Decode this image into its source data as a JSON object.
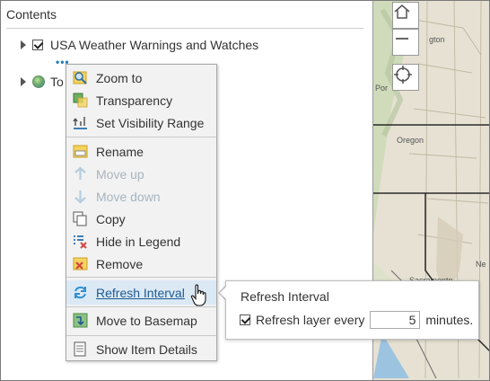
{
  "contents": {
    "title": "Contents",
    "layers": [
      {
        "label": "USA Weather Warnings and Watches",
        "checked": true
      },
      {
        "label": "To"
      }
    ]
  },
  "menu": {
    "items": [
      {
        "label": "Zoom to",
        "icon": "zoom-to-icon",
        "enabled": true
      },
      {
        "label": "Transparency",
        "icon": "transparency-icon",
        "enabled": true
      },
      {
        "label": "Set Visibility Range",
        "icon": "visibility-range-icon",
        "enabled": true
      },
      {
        "label": "Rename",
        "icon": "rename-icon",
        "enabled": true
      },
      {
        "label": "Move up",
        "icon": "arrow-up-icon",
        "enabled": false
      },
      {
        "label": "Move down",
        "icon": "arrow-down-icon",
        "enabled": false
      },
      {
        "label": "Copy",
        "icon": "copy-icon",
        "enabled": true
      },
      {
        "label": "Hide in Legend",
        "icon": "hide-legend-icon",
        "enabled": true
      },
      {
        "label": "Remove",
        "icon": "remove-icon",
        "enabled": true
      },
      {
        "label": "Refresh Interval",
        "icon": "refresh-icon",
        "enabled": true,
        "active": true
      },
      {
        "label": "Move to Basemap",
        "icon": "move-basemap-icon",
        "enabled": true
      },
      {
        "label": "Show Item Details",
        "icon": "item-details-icon",
        "enabled": true
      }
    ]
  },
  "refresh_flyout": {
    "title": "Refresh Interval",
    "checkbox_label": "Refresh layer every",
    "checked": true,
    "value": "5",
    "unit": "minutes."
  },
  "map": {
    "labels": [
      "gton",
      "Por",
      "Oregon",
      "Sacramento",
      "Ne"
    ],
    "controls": [
      "home-icon",
      "zoom-out-icon",
      "locate-icon"
    ]
  },
  "colors": {
    "accent": "#1d5a8f",
    "active_bg": "#dbe9f5",
    "menu_bg": "#f2f2f2",
    "disabled_text": "#a8b4be"
  }
}
